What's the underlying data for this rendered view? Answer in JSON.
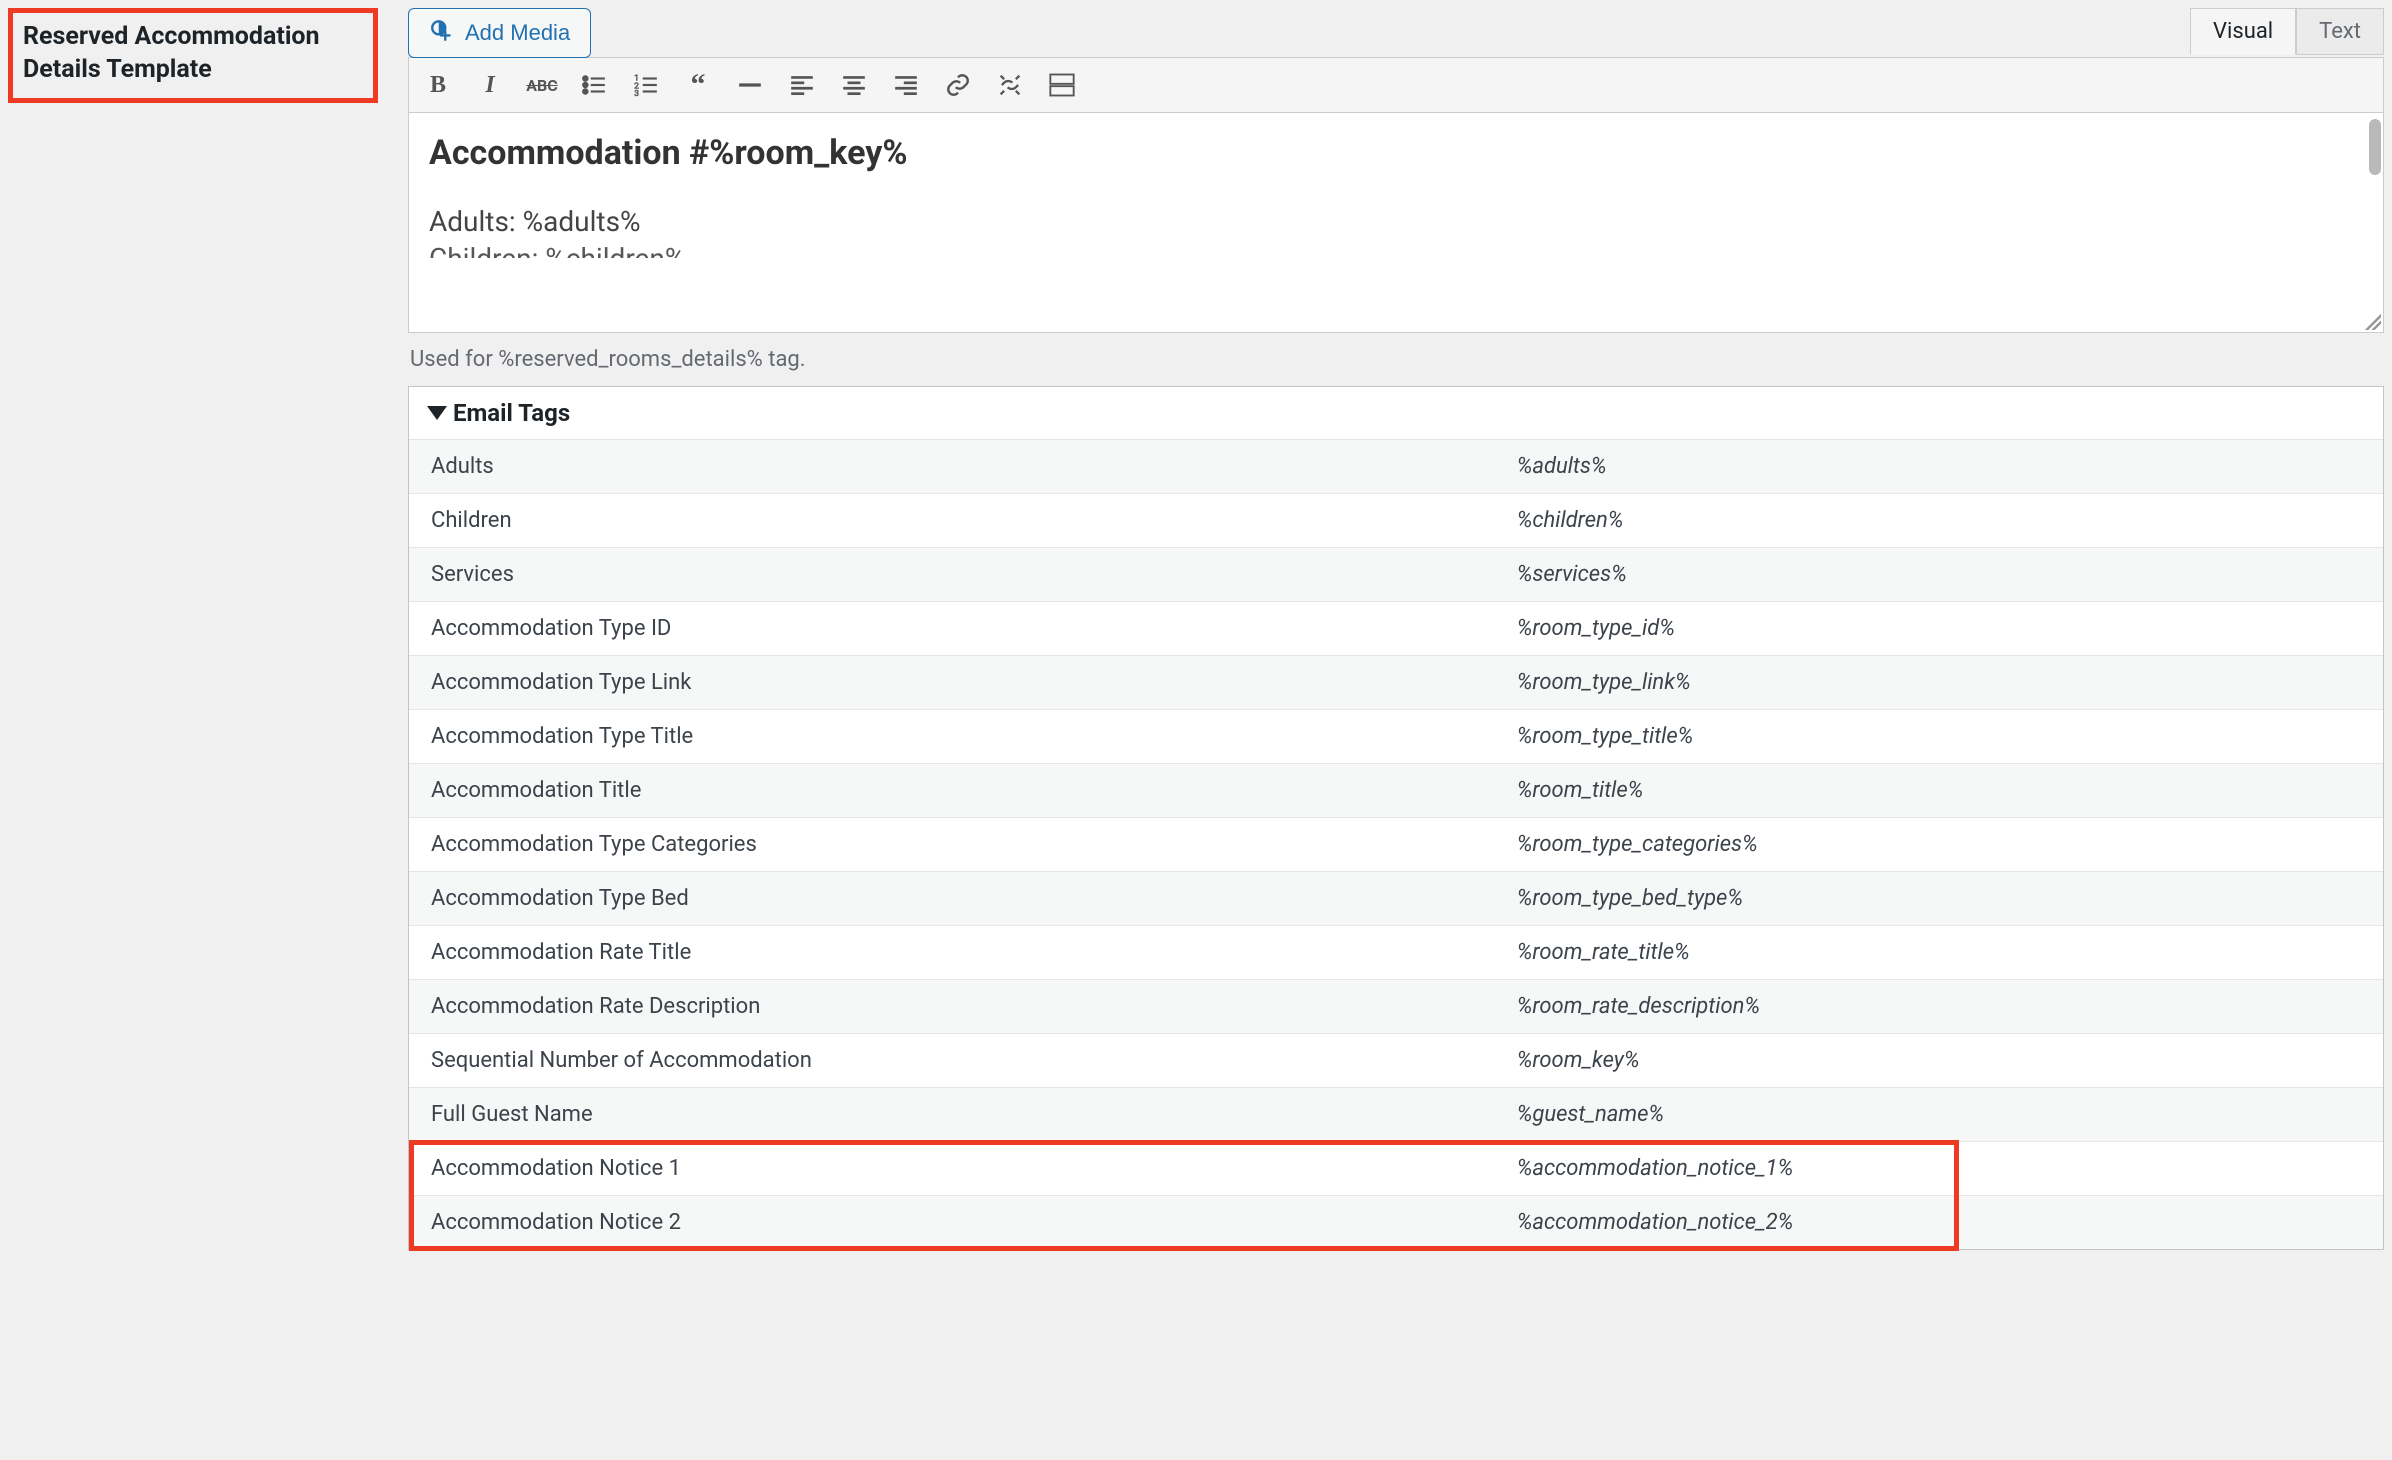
{
  "sidebar": {
    "title": "Reserved Accommodation Details Template"
  },
  "toolbar_top": {
    "add_media": "Add Media"
  },
  "editor_tabs": {
    "visual": "Visual",
    "text": "Text"
  },
  "editor_content": {
    "heading": "Accommodation #%room_key%",
    "line1": "Adults: %adults%",
    "line2": "Children: %children%"
  },
  "helper": "Used for %reserved_rooms_details% tag.",
  "email_tags": {
    "summary": "Email Tags",
    "rows": [
      {
        "label": "Adults",
        "tag": "%adults%"
      },
      {
        "label": "Children",
        "tag": "%children%"
      },
      {
        "label": "Services",
        "tag": "%services%"
      },
      {
        "label": "Accommodation Type ID",
        "tag": "%room_type_id%"
      },
      {
        "label": "Accommodation Type Link",
        "tag": "%room_type_link%"
      },
      {
        "label": "Accommodation Type Title",
        "tag": "%room_type_title%"
      },
      {
        "label": "Accommodation Title",
        "tag": "%room_title%"
      },
      {
        "label": "Accommodation Type Categories",
        "tag": "%room_type_categories%"
      },
      {
        "label": "Accommodation Type Bed",
        "tag": "%room_type_bed_type%"
      },
      {
        "label": "Accommodation Rate Title",
        "tag": "%room_rate_title%"
      },
      {
        "label": "Accommodation Rate Description",
        "tag": "%room_rate_description%"
      },
      {
        "label": "Sequential Number of Accommodation",
        "tag": "%room_key%"
      },
      {
        "label": "Full Guest Name",
        "tag": "%guest_name%"
      },
      {
        "label": "Accommodation Notice 1",
        "tag": "%accommodation_notice_1%"
      },
      {
        "label": "Accommodation Notice 2",
        "tag": "%accommodation_notice_2%"
      }
    ]
  }
}
